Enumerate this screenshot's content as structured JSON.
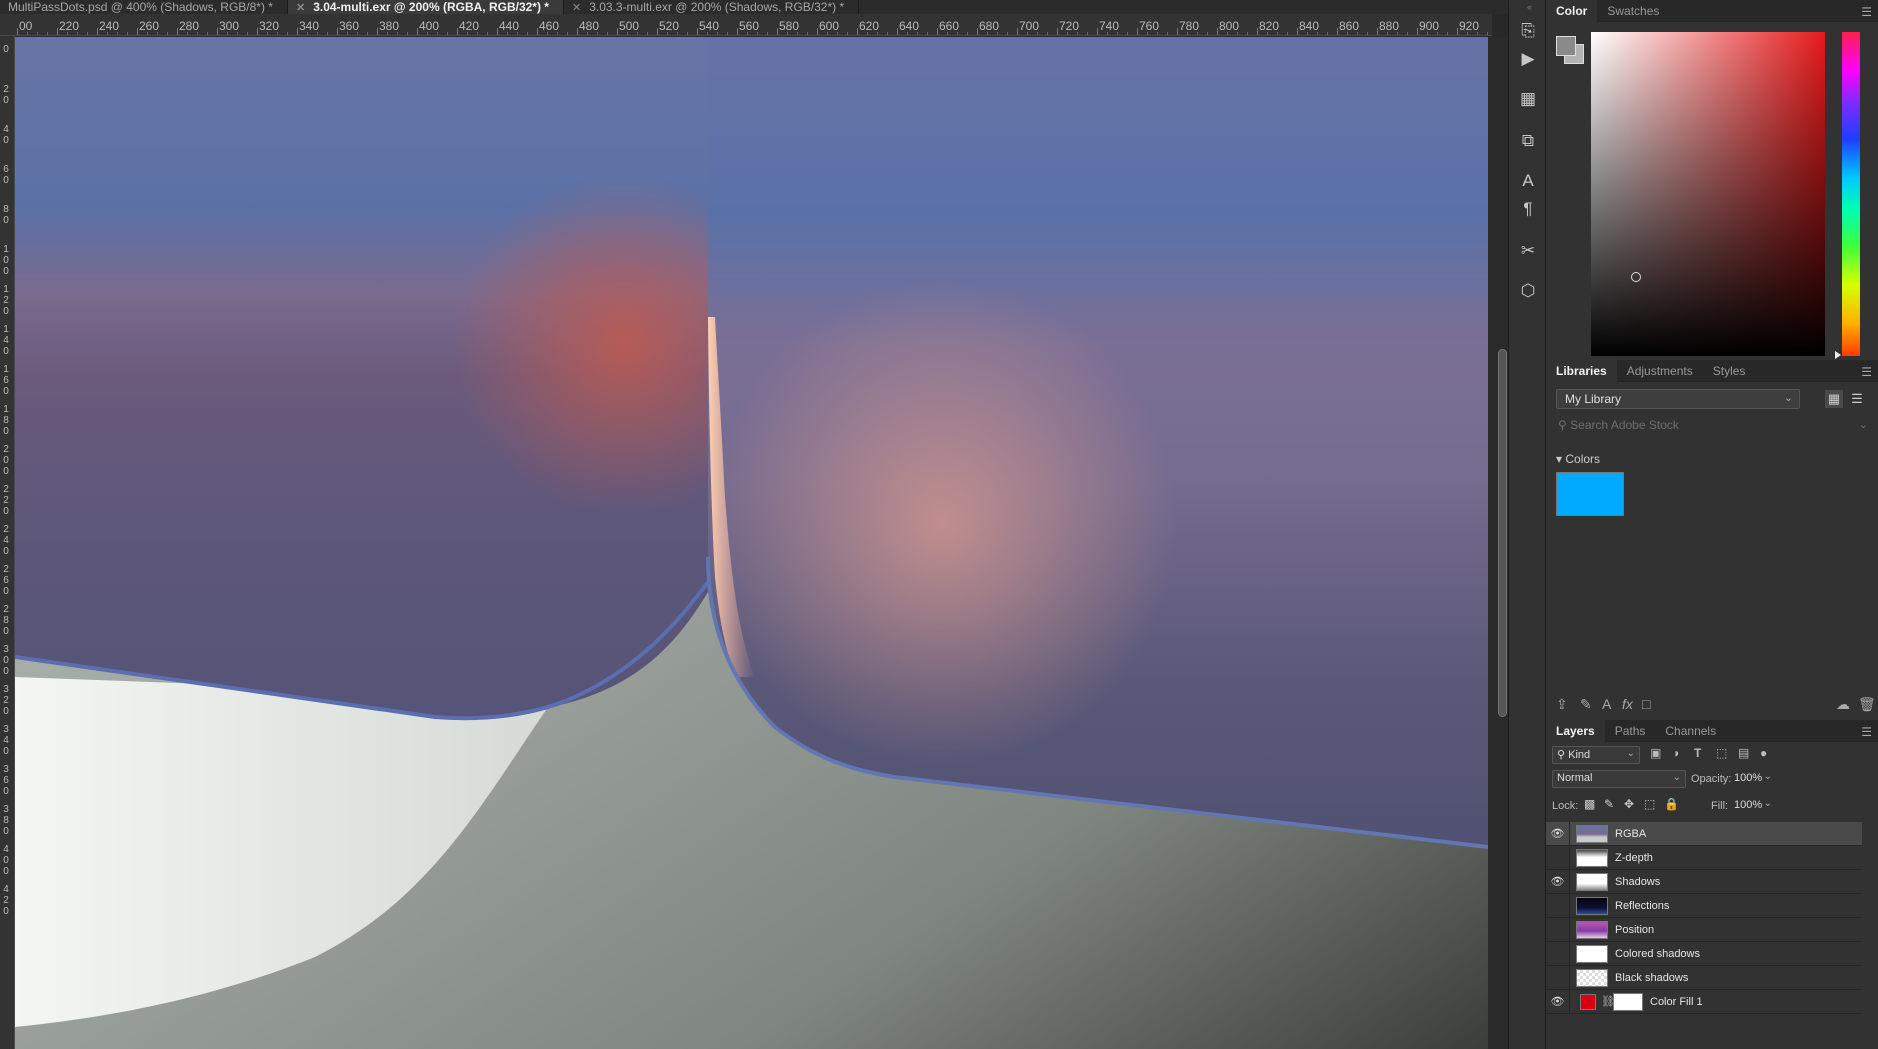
{
  "document_tabs": [
    {
      "label": "MultiPassDots.psd @ 400% (Shadows, RGB/8*) *",
      "active": false
    },
    {
      "label": "3.04-multi.exr @ 200% (RGBA, RGB/32*) *",
      "active": true
    },
    {
      "label": "3.03.3-multi.exr @ 200% (Shadows, RGB/32*) *",
      "active": false
    }
  ],
  "ruler": {
    "horizontal_labels": [
      "00",
      "220",
      "240",
      "260",
      "280",
      "300",
      "320",
      "340",
      "360",
      "380",
      "400",
      "420",
      "440",
      "460",
      "480",
      "500",
      "520",
      "540",
      "560",
      "580",
      "600",
      "620",
      "640",
      "660",
      "680",
      "700",
      "720",
      "740",
      "760",
      "780",
      "800",
      "820",
      "840",
      "860",
      "880",
      "900",
      "920"
    ],
    "vertical_labels": [
      "0",
      "2 0",
      "4 0",
      "6 0",
      "8 0",
      "1 0 0",
      "1 2 0",
      "1 4 0",
      "1 6 0",
      "1 8 0",
      "2 0 0",
      "2 2 0",
      "2 4 0",
      "2 6 0",
      "2 8 0",
      "3 0 0",
      "3 2 0",
      "3 4 0",
      "3 6 0",
      "3 8 0",
      "4 0 0",
      "4 2 0"
    ]
  },
  "color_panel": {
    "tabs": [
      "Color",
      "Swatches"
    ],
    "foreground": "#8a8a8a",
    "background": "#b4b4b4",
    "hue_color": "#e61a1a"
  },
  "libraries_panel": {
    "tabs": [
      "Libraries",
      "Adjustments",
      "Styles"
    ],
    "library_name": "My Library",
    "search_placeholder": "Search Adobe Stock",
    "colors_heading": "Colors",
    "color_swatch": "#00aaff"
  },
  "layers_panel": {
    "tabs": [
      "Layers",
      "Paths",
      "Channels"
    ],
    "filter_kind": "Kind",
    "blend_mode": "Normal",
    "opacity_label": "Opacity:",
    "opacity": "100%",
    "lock_label": "Lock:",
    "fill_label": "Fill:",
    "fill": "100%",
    "layers": [
      {
        "name": "RGBA",
        "visible": true,
        "selected": true
      },
      {
        "name": "Z-depth",
        "visible": false,
        "selected": false
      },
      {
        "name": "Shadows",
        "visible": true,
        "selected": false
      },
      {
        "name": "Reflections",
        "visible": false,
        "selected": false
      },
      {
        "name": "Position",
        "visible": false,
        "selected": false
      },
      {
        "name": "Colored shadows",
        "visible": false,
        "selected": false
      },
      {
        "name": "Black shadows",
        "visible": false,
        "selected": false
      },
      {
        "name": "Color Fill 1",
        "visible": true,
        "selected": false
      }
    ]
  }
}
